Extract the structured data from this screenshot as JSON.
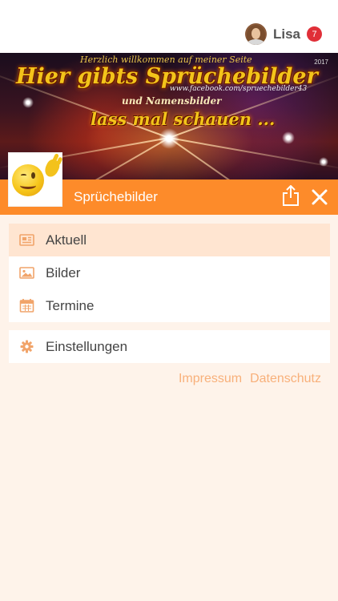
{
  "user": {
    "name": "Lisa",
    "notifications": "7"
  },
  "banner": {
    "top_line": "Herzlich willkommen auf meiner Seite",
    "year": "2017",
    "title": "Hier gibts Sprüchebilder",
    "url": "www.facebook.com/spruechebilder43",
    "subtitle": "und Namensbilder",
    "cta": "lass mal schauen ..."
  },
  "page": {
    "name": "Sprüchebilder"
  },
  "menu": {
    "items": [
      {
        "label": "Aktuell",
        "icon": "news-icon",
        "active": true
      },
      {
        "label": "Bilder",
        "icon": "image-icon",
        "active": false
      },
      {
        "label": "Termine",
        "icon": "calendar-icon",
        "active": false
      }
    ],
    "settings": {
      "label": "Einstellungen",
      "icon": "gear-icon"
    }
  },
  "footer": {
    "impressum": "Impressum",
    "datenschutz": "Datenschutz"
  },
  "colors": {
    "accent": "#fd8b2a",
    "background": "#fef3ea",
    "active_row": "#ffe5d1",
    "badge": "#e02f38",
    "link": "#f8b07a"
  }
}
